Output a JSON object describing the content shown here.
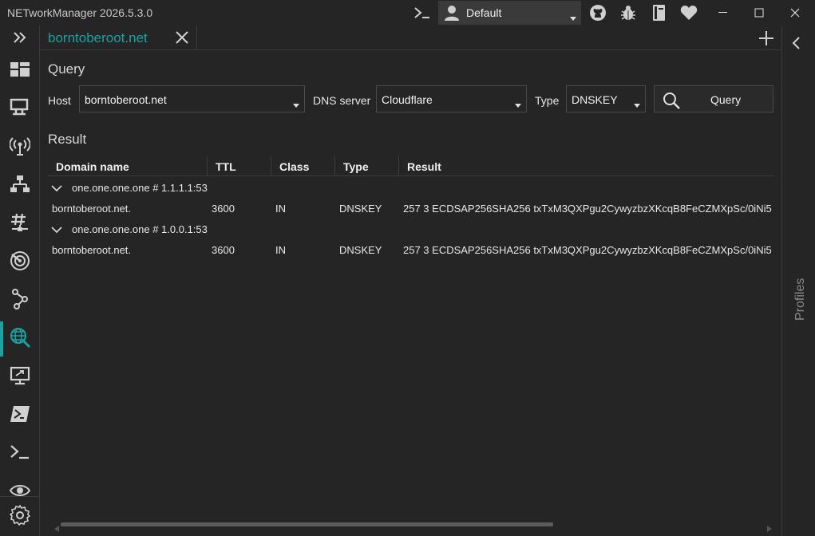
{
  "window": {
    "title": "NETworkManager 2026.5.3.0"
  },
  "titlebar": {
    "profile": "Default",
    "icons": [
      "terminal-icon",
      "user-icon",
      "github-icon",
      "bug-icon",
      "book-icon",
      "heart-icon"
    ],
    "window_buttons": [
      "minimize-icon",
      "maximize-icon",
      "close-icon"
    ]
  },
  "sidebar": {
    "items": [
      {
        "icon": "expand-icon"
      },
      {
        "icon": "dashboard-icon"
      },
      {
        "icon": "network-interface-icon"
      },
      {
        "icon": "wifi-icon"
      },
      {
        "icon": "ip-scanner-icon"
      },
      {
        "icon": "port-scanner-icon"
      },
      {
        "icon": "ping-monitor-icon"
      },
      {
        "icon": "traceroute-icon"
      },
      {
        "icon": "dns-lookup-icon",
        "active": true
      },
      {
        "icon": "remote-desktop-icon"
      },
      {
        "icon": "powershell-icon"
      },
      {
        "icon": "putty-icon"
      },
      {
        "icon": "tightvnc-icon"
      },
      {
        "icon": "settings-icon"
      }
    ],
    "accent": "#1aa3a3"
  },
  "tabs": [
    {
      "label": "borntoberoot.net"
    }
  ],
  "query": {
    "section_title": "Query",
    "host_label": "Host",
    "host_value": "borntoberoot.net",
    "dns_server_label": "DNS server",
    "dns_server_value": "Cloudflare",
    "type_label": "Type",
    "type_value": "DNSKEY",
    "button_label": "Query"
  },
  "result": {
    "section_title": "Result",
    "columns": [
      "Domain name",
      "TTL",
      "Class",
      "Type",
      "Result"
    ],
    "groups": [
      {
        "header": "one.one.one.one # 1.1.1.1:53",
        "rows": [
          {
            "domain": "borntoberoot.net.",
            "ttl": "3600",
            "class": "IN",
            "type": "DNSKEY",
            "result": "257 3 ECDSAP256SHA256 txTxM3QXPgu2CywyzbzXKcqB8FeCZMXpSc/0iNi5"
          }
        ]
      },
      {
        "header": "one.one.one.one # 1.0.0.1:53",
        "rows": [
          {
            "domain": "borntoberoot.net.",
            "ttl": "3600",
            "class": "IN",
            "type": "DNSKEY",
            "result": "257 3 ECDSAP256SHA256 txTxM3QXPgu2CywyzbzXKcqB8FeCZMXpSc/0iNi5"
          }
        ]
      }
    ]
  },
  "profiles_panel": {
    "label": "Profiles"
  }
}
